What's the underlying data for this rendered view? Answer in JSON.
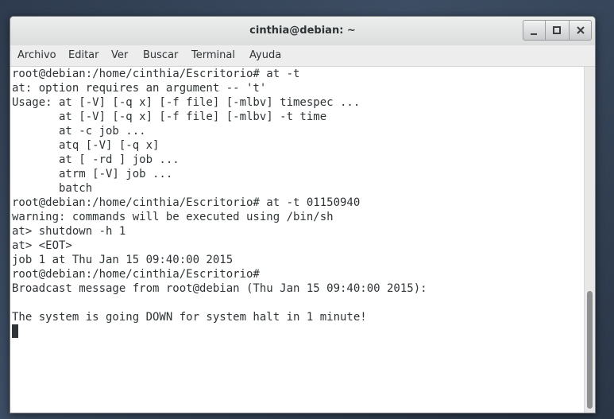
{
  "window": {
    "title": "cinthia@debian: ~"
  },
  "menu": {
    "items": [
      "Archivo",
      "Editar",
      "Ver",
      "Buscar",
      "Terminal",
      "Ayuda"
    ]
  },
  "terminal": {
    "lines": [
      "root@debian:/home/cinthia/Escritorio# at -t",
      "at: option requires an argument -- 't'",
      "Usage: at [-V] [-q x] [-f file] [-mlbv] timespec ...",
      "       at [-V] [-q x] [-f file] [-mlbv] -t time",
      "       at -c job ...",
      "       atq [-V] [-q x]",
      "       at [ -rd ] job ...",
      "       atrm [-V] job ...",
      "       batch",
      "root@debian:/home/cinthia/Escritorio# at -t 01150940",
      "warning: commands will be executed using /bin/sh",
      "at> shutdown -h 1",
      "at> <EOT>",
      "job 1 at Thu Jan 15 09:40:00 2015",
      "root@debian:/home/cinthia/Escritorio#",
      "Broadcast message from root@debian (Thu Jan 15 09:40:00 2015):",
      "",
      "The system is going DOWN for system halt in 1 minute!"
    ]
  },
  "icons": {
    "minimize": "minimize-icon",
    "maximize": "maximize-icon",
    "close": "close-icon"
  },
  "colors": {
    "terminal_fg": "#2e3436",
    "terminal_bg": "#ffffff"
  }
}
